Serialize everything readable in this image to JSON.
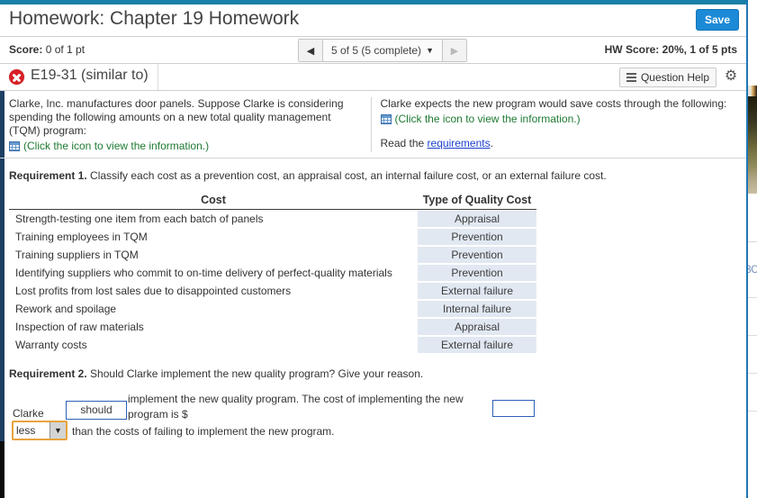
{
  "header": {
    "title": "Homework: Chapter 19 Homework",
    "save_label": "Save"
  },
  "score_bar": {
    "score_label": "Score:",
    "score_value": "0 of 1 pt",
    "pager_prev_icon": "triangle-left-icon",
    "pager_label": "5 of 5 (5 complete)",
    "pager_caret_icon": "caret-down-icon",
    "pager_next_icon": "triangle-right-icon",
    "hw_score": "HW Score: 20%, 1 of 5 pts"
  },
  "exercise_bar": {
    "status_icon": "incorrect-x-icon",
    "exercise_id": "E19-31 (similar to)",
    "question_help_label": "Question Help",
    "help_icon": "list-lines-icon",
    "gear_icon": "gear-icon"
  },
  "problem": {
    "left_text": "Clarke, Inc. manufactures door panels. Suppose Clarke is considering spending the following amounts on a new total quality management (TQM) program:",
    "left_icon_link": "(Click the icon to view the information.)",
    "left_icon": "spreadsheet-grid-icon",
    "right_text": "Clarke expects the new program would save costs through the following:",
    "right_icon_link": "(Click the icon to view the information.)",
    "right_icon": "spreadsheet-grid-icon",
    "read_prefix": "Read the ",
    "read_link": "requirements",
    "read_suffix": "."
  },
  "requirement1": {
    "label": "Requirement 1.",
    "text": " Classify each cost as a prevention cost, an appraisal cost, an internal failure cost, or an external failure cost.",
    "columns": [
      "Cost",
      "Type of Quality Cost"
    ],
    "rows": [
      {
        "cost": "Strength-testing one item from each batch of panels",
        "type": "Appraisal"
      },
      {
        "cost": "Training employees in TQM",
        "type": "Prevention"
      },
      {
        "cost": "Training suppliers in TQM",
        "type": "Prevention"
      },
      {
        "cost": "Identifying suppliers who commit to on-time delivery of perfect-quality materials",
        "type": "Prevention"
      },
      {
        "cost": "Lost profits from lost sales due to disappointed customers",
        "type": "External failure"
      },
      {
        "cost": "Rework and spoilage",
        "type": "Internal failure"
      },
      {
        "cost": "Inspection of raw materials",
        "type": "Appraisal"
      },
      {
        "cost": "Warranty costs",
        "type": "External failure"
      }
    ]
  },
  "requirement2": {
    "label": "Requirement 2.",
    "text": " Should Clarke implement the new quality program? Give your reason.",
    "subject": "Clarke",
    "should_value": "should",
    "sentence": "implement the new quality program. The cost of implementing the new program is $",
    "amount_value": "",
    "comparison_value": "less",
    "comparison_arrow_icon": "caret-down-icon",
    "tail_text": "than the costs of failing to implement the new program."
  },
  "background": {
    "partial_text": "3C"
  },
  "colors": {
    "accent_teal": "#1a7fa8",
    "save_blue": "#1c8ad6",
    "answer_cell": "#e1e8f2",
    "focus_orange": "#e8a33d",
    "input_border_blue": "#2d5fb9",
    "link_green": "#1f7a33",
    "link_blue": "#1a3fd0",
    "error_red": "#d81f26"
  }
}
